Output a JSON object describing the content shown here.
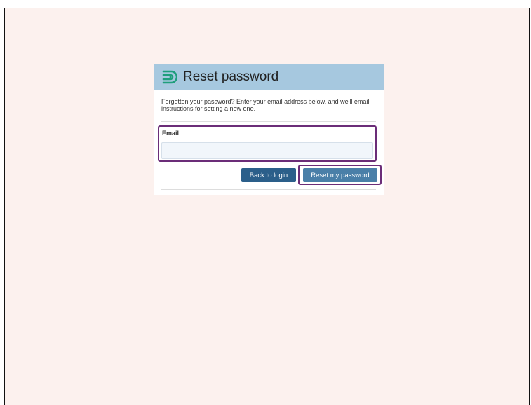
{
  "dialog": {
    "title": "Reset password",
    "description": "Forgotten your password? Enter your email address below, and we'll email instructions for setting a new one.",
    "logo_icon": "app-logo-icon"
  },
  "form": {
    "email_label": "Email",
    "email_value": "",
    "email_placeholder": ""
  },
  "buttons": {
    "back_label": "Back to login",
    "reset_label": "Reset my password"
  },
  "colors": {
    "page_background": "#fcf1ee",
    "header_background": "#a6c8df",
    "logo_color": "#1f9e7c",
    "highlight_border": "#6b2d78",
    "back_button": "#2b5f8a",
    "reset_button": "#4a7fa8"
  }
}
